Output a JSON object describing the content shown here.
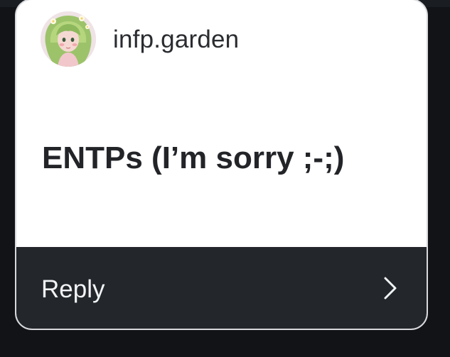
{
  "post": {
    "username": "infp.garden",
    "text": "ENTPs (I’m sorry ;-;)",
    "avatar_icon": "avatar-illustration-icon"
  },
  "reply": {
    "label": "Reply",
    "icon": "chevron-right-icon"
  },
  "colors": {
    "background": "#111316",
    "card": "#ffffff",
    "card_border": "#d7d9dc",
    "reply_bar": "#23262b",
    "text_dark": "#222428",
    "text_light": "#f2f3f5"
  }
}
